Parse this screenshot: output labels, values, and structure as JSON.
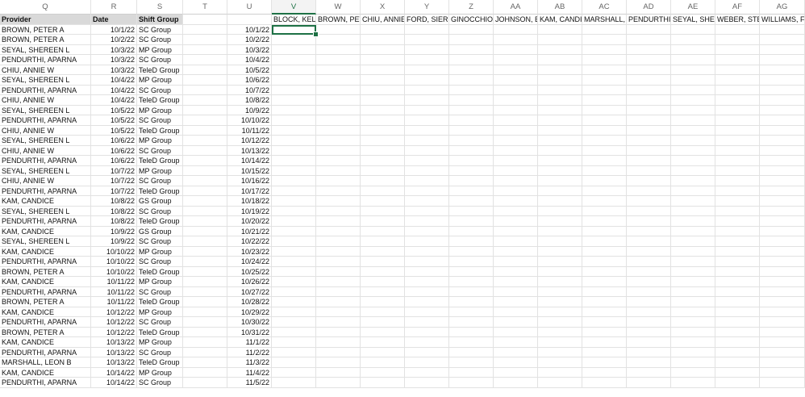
{
  "columns": [
    "Q",
    "R",
    "S",
    "T",
    "U",
    "V",
    "W",
    "X",
    "Y",
    "Z",
    "AA",
    "AB",
    "AC",
    "AD",
    "AE",
    "AF",
    "AG"
  ],
  "selected_column": "V",
  "headers": {
    "provider": "Provider",
    "date": "Date",
    "shift_group": "Shift Group"
  },
  "provider_headers": [
    "BLOCK, KELLY",
    "BROWN, PETER",
    "CHIU, ANNIE",
    "FORD, SIERRA",
    "GINOCCHIO,",
    "JOHNSON, B",
    "KAM, CANDICE",
    "MARSHALL, L",
    "PENDURTHI,",
    "SEYAL, SHEREEN",
    "WEBER, STEVE",
    "WILLIAMS, F"
  ],
  "rows": [
    [
      "BROWN, PETER A",
      "10/1/22",
      "SC Group",
      "10/1/22"
    ],
    [
      "BROWN, PETER A",
      "10/2/22",
      "SC Group",
      "10/2/22"
    ],
    [
      "SEYAL, SHEREEN L",
      "10/3/22",
      "MP Group",
      "10/3/22"
    ],
    [
      "PENDURTHI, APARNA",
      "10/3/22",
      "SC Group",
      "10/4/22"
    ],
    [
      "CHIU, ANNIE W",
      "10/3/22",
      "TeleD Group",
      "10/5/22"
    ],
    [
      "SEYAL, SHEREEN L",
      "10/4/22",
      "MP Group",
      "10/6/22"
    ],
    [
      "PENDURTHI, APARNA",
      "10/4/22",
      "SC Group",
      "10/7/22"
    ],
    [
      "CHIU, ANNIE W",
      "10/4/22",
      "TeleD Group",
      "10/8/22"
    ],
    [
      "SEYAL, SHEREEN L",
      "10/5/22",
      "MP Group",
      "10/9/22"
    ],
    [
      "PENDURTHI, APARNA",
      "10/5/22",
      "SC Group",
      "10/10/22"
    ],
    [
      "CHIU, ANNIE W",
      "10/5/22",
      "TeleD Group",
      "10/11/22"
    ],
    [
      "SEYAL, SHEREEN L",
      "10/6/22",
      "MP Group",
      "10/12/22"
    ],
    [
      "CHIU, ANNIE W",
      "10/6/22",
      "SC Group",
      "10/13/22"
    ],
    [
      "PENDURTHI, APARNA",
      "10/6/22",
      "TeleD Group",
      "10/14/22"
    ],
    [
      "SEYAL, SHEREEN L",
      "10/7/22",
      "MP Group",
      "10/15/22"
    ],
    [
      "CHIU, ANNIE W",
      "10/7/22",
      "SC Group",
      "10/16/22"
    ],
    [
      "PENDURTHI, APARNA",
      "10/7/22",
      "TeleD Group",
      "10/17/22"
    ],
    [
      "KAM, CANDICE",
      "10/8/22",
      "GS Group",
      "10/18/22"
    ],
    [
      "SEYAL, SHEREEN L",
      "10/8/22",
      "SC Group",
      "10/19/22"
    ],
    [
      "PENDURTHI, APARNA",
      "10/8/22",
      "TeleD Group",
      "10/20/22"
    ],
    [
      "KAM, CANDICE",
      "10/9/22",
      "GS Group",
      "10/21/22"
    ],
    [
      "SEYAL, SHEREEN L",
      "10/9/22",
      "SC Group",
      "10/22/22"
    ],
    [
      "KAM, CANDICE",
      "10/10/22",
      "MP Group",
      "10/23/22"
    ],
    [
      "PENDURTHI, APARNA",
      "10/10/22",
      "SC Group",
      "10/24/22"
    ],
    [
      "BROWN, PETER A",
      "10/10/22",
      "TeleD Group",
      "10/25/22"
    ],
    [
      "KAM, CANDICE",
      "10/11/22",
      "MP Group",
      "10/26/22"
    ],
    [
      "PENDURTHI, APARNA",
      "10/11/22",
      "SC Group",
      "10/27/22"
    ],
    [
      "BROWN, PETER A",
      "10/11/22",
      "TeleD Group",
      "10/28/22"
    ],
    [
      "KAM, CANDICE",
      "10/12/22",
      "MP Group",
      "10/29/22"
    ],
    [
      "PENDURTHI, APARNA",
      "10/12/22",
      "SC Group",
      "10/30/22"
    ],
    [
      "BROWN, PETER A",
      "10/12/22",
      "TeleD Group",
      "10/31/22"
    ],
    [
      "KAM, CANDICE",
      "10/13/22",
      "MP Group",
      "11/1/22"
    ],
    [
      "PENDURTHI, APARNA",
      "10/13/22",
      "SC Group",
      "11/2/22"
    ],
    [
      "MARSHALL, LEON B",
      "10/13/22",
      "TeleD Group",
      "11/3/22"
    ],
    [
      "KAM, CANDICE",
      "10/14/22",
      "MP Group",
      "11/4/22"
    ],
    [
      "PENDURTHI, APARNA",
      "10/14/22",
      "SC Group",
      "11/5/22"
    ]
  ]
}
